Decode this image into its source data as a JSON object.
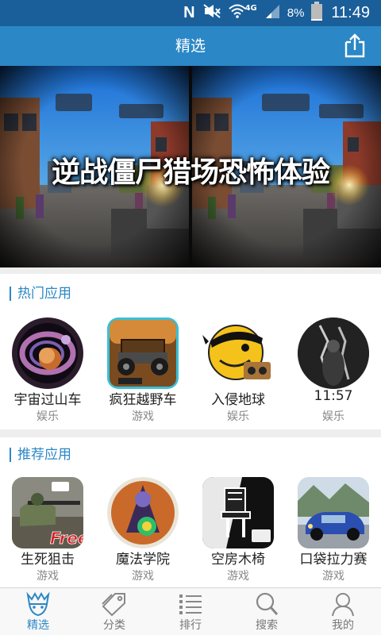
{
  "status_bar": {
    "network_type": "4G",
    "battery_percent": "8%",
    "time": "11:49"
  },
  "app_bar": {
    "title": "精选"
  },
  "banner": {
    "title": "逆战僵尸猎场恐怖体验"
  },
  "sections": [
    {
      "title": "热门应用",
      "apps": [
        {
          "name": "宇宙过山车",
          "category": "娱乐",
          "icon": "space-coaster-icon"
        },
        {
          "name": "疯狂越野车",
          "category": "游戏",
          "icon": "offroad-car-icon"
        },
        {
          "name": "入侵地球",
          "category": "娱乐",
          "icon": "pirate-smiley-icon"
        },
        {
          "name": "11:57",
          "category": "娱乐",
          "icon": "dark-figure-icon"
        }
      ]
    },
    {
      "title": "推荐应用",
      "apps": [
        {
          "name": "生死狙击",
          "category": "游戏",
          "icon": "sniper-icon"
        },
        {
          "name": "魔法学院",
          "category": "游戏",
          "icon": "wizard-icon"
        },
        {
          "name": "空房木椅",
          "category": "游戏",
          "icon": "chair-icon"
        },
        {
          "name": "口袋拉力赛",
          "category": "游戏",
          "icon": "rally-car-icon"
        }
      ]
    }
  ],
  "bottom_nav": [
    {
      "label": "精选",
      "icon": "featured-icon",
      "active": true
    },
    {
      "label": "分类",
      "icon": "tag-icon",
      "active": false
    },
    {
      "label": "排行",
      "icon": "list-icon",
      "active": false
    },
    {
      "label": "搜索",
      "icon": "search-icon",
      "active": false
    },
    {
      "label": "我的",
      "icon": "user-icon",
      "active": false
    }
  ],
  "colors": {
    "status_bar": "#1a5f9a",
    "app_bar": "#2b87c5",
    "accent": "#2b87c5",
    "inactive": "#777777",
    "section_band": "#eeeeee"
  }
}
